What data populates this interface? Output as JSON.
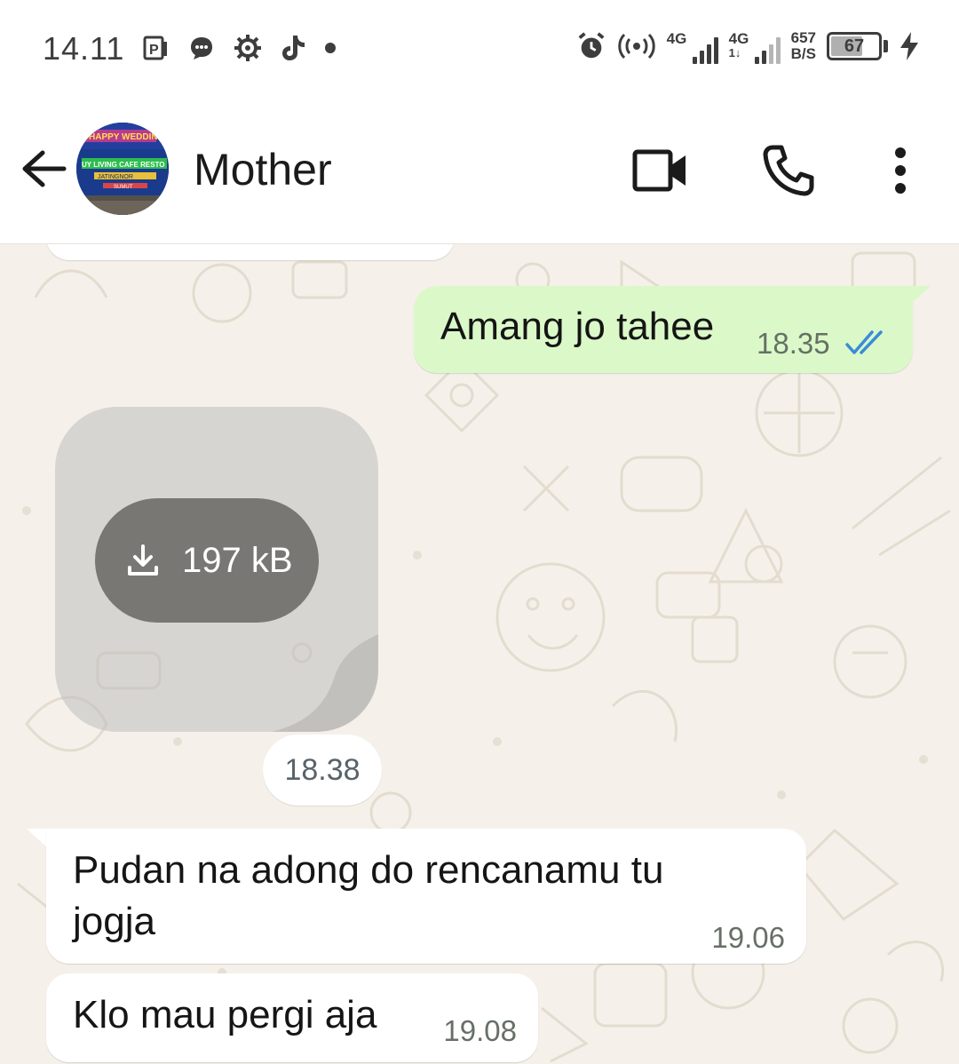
{
  "status_bar": {
    "time": "14.11",
    "net1_label": "4G",
    "net2_label": "4G",
    "net2_sub": "1↓",
    "speed_value": "657",
    "speed_unit": "B/S",
    "battery": "67",
    "battery_level": 0.67,
    "left_icons": [
      "parking-app-icon",
      "message-bubble-icon",
      "gear-icon",
      "tiktok-icon",
      "dot-icon"
    ],
    "right_icons": [
      "alarm-icon",
      "hotspot-icon",
      "signal-icon",
      "signal-icon",
      "battery-icon",
      "charging-icon"
    ]
  },
  "header": {
    "contact_name": "Mother",
    "avatar_text": [
      "HAPPY WEDDING",
      "UY LIVING CAFE RESTO",
      "JATINGNOR",
      "SUMUT"
    ]
  },
  "messages": [
    {
      "id": "m1",
      "direction": "out",
      "text": "Amang jo tahee",
      "time": "18.35",
      "status": "read"
    },
    {
      "id": "m2",
      "direction": "in",
      "type": "sticker",
      "size_label": "197 kB"
    },
    {
      "id": "m2t",
      "type": "time-chip",
      "text": "18.38"
    },
    {
      "id": "m3",
      "direction": "in",
      "text_line1": "Pudan na adong do rencanamu tu",
      "text_line2": "jogja",
      "time": "19.06"
    },
    {
      "id": "m4",
      "direction": "in",
      "text": "Klo mau pergi aja",
      "time": "19.08"
    }
  ],
  "colors": {
    "chat_bg": "#f5f1ea",
    "bubble_out": "#dbf9c8",
    "bubble_in": "#ffffff",
    "read_tick": "#3a8bd9"
  }
}
